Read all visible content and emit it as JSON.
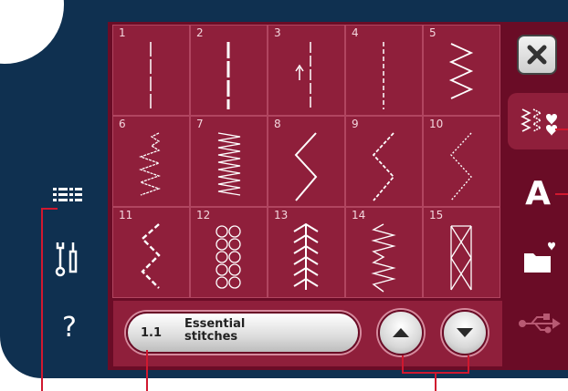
{
  "stitch_grid": {
    "cells": [
      {
        "number": "1"
      },
      {
        "number": "2"
      },
      {
        "number": "3"
      },
      {
        "number": "4"
      },
      {
        "number": "5"
      },
      {
        "number": "6"
      },
      {
        "number": "7"
      },
      {
        "number": "8"
      },
      {
        "number": "9"
      },
      {
        "number": "10"
      },
      {
        "number": "11"
      },
      {
        "number": "12"
      },
      {
        "number": "13"
      },
      {
        "number": "14"
      },
      {
        "number": "15"
      }
    ]
  },
  "menu_selector": {
    "code": "1.1",
    "label": "Essential\nstitches"
  },
  "side_menu": {
    "items": [
      {
        "icon": "stitch-menu-icon"
      },
      {
        "icon": "settings-tools-icon"
      },
      {
        "icon": "help-icon"
      }
    ],
    "help_label": "?"
  },
  "tabs": [
    {
      "icon": "close-icon"
    },
    {
      "icon": "stitches-tab-icon",
      "active": true
    },
    {
      "icon": "font-tab-icon",
      "label": "A"
    },
    {
      "icon": "folder-tab-icon"
    },
    {
      "icon": "usb-tab-icon"
    }
  ],
  "colors": {
    "frame": "#0f3050",
    "screen": "#6a0c26",
    "cell": "#8f1f3b",
    "callout": "#d0182f"
  }
}
